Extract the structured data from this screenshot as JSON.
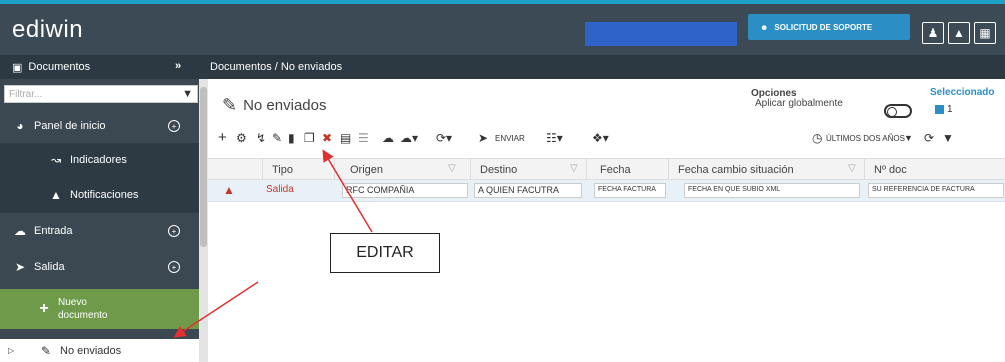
{
  "header": {
    "logo": "ediwin",
    "support_label": "SOLICITUD DE SOPORTE"
  },
  "subbar": {
    "section": "Documentos",
    "breadcrumb": "Documentos  /  No enviados"
  },
  "sidebar": {
    "filter_placeholder": "Filtrar...",
    "items": [
      {
        "label": "Panel de inicio"
      },
      {
        "label": "Indicadores"
      },
      {
        "label": "Notificaciones"
      },
      {
        "label": "Entrada"
      },
      {
        "label": "Salida"
      },
      {
        "label": "Nuevo documento"
      },
      {
        "label": "No enviados"
      }
    ]
  },
  "main": {
    "title": "No enviados",
    "opciones_label": "Opciones",
    "aplicar_label": "Aplicar globalmente",
    "seleccionados_label": "Seleccionado",
    "seleccionados_count": "1",
    "toolbar": {
      "enviar_label": "ENVIAR",
      "range_label": "ÚLTIMOS DOS AÑOS"
    },
    "columns": [
      "Tipo",
      "Origen",
      "Destino",
      "Fecha",
      "Fecha cambio situación",
      "Nº doc"
    ],
    "rows": [
      {
        "tipo": "Salida",
        "origen": "RFC COMPAÑIA",
        "destino": "A QUIEN FACUTRA",
        "fecha": "FECHA FACTURA",
        "fecha_cambio": "FECHA EN QUE SUBIO XML",
        "ndoc": "SU REFERENCIA DE FACTURA"
      }
    ]
  },
  "annotation": {
    "label": "EDITAR",
    "arrow_color": "#e03030"
  },
  "colors": {
    "header": "#3b4a55",
    "accent": "#1da1c9",
    "support": "#2b8fc6",
    "green": "#6e9a4a"
  }
}
